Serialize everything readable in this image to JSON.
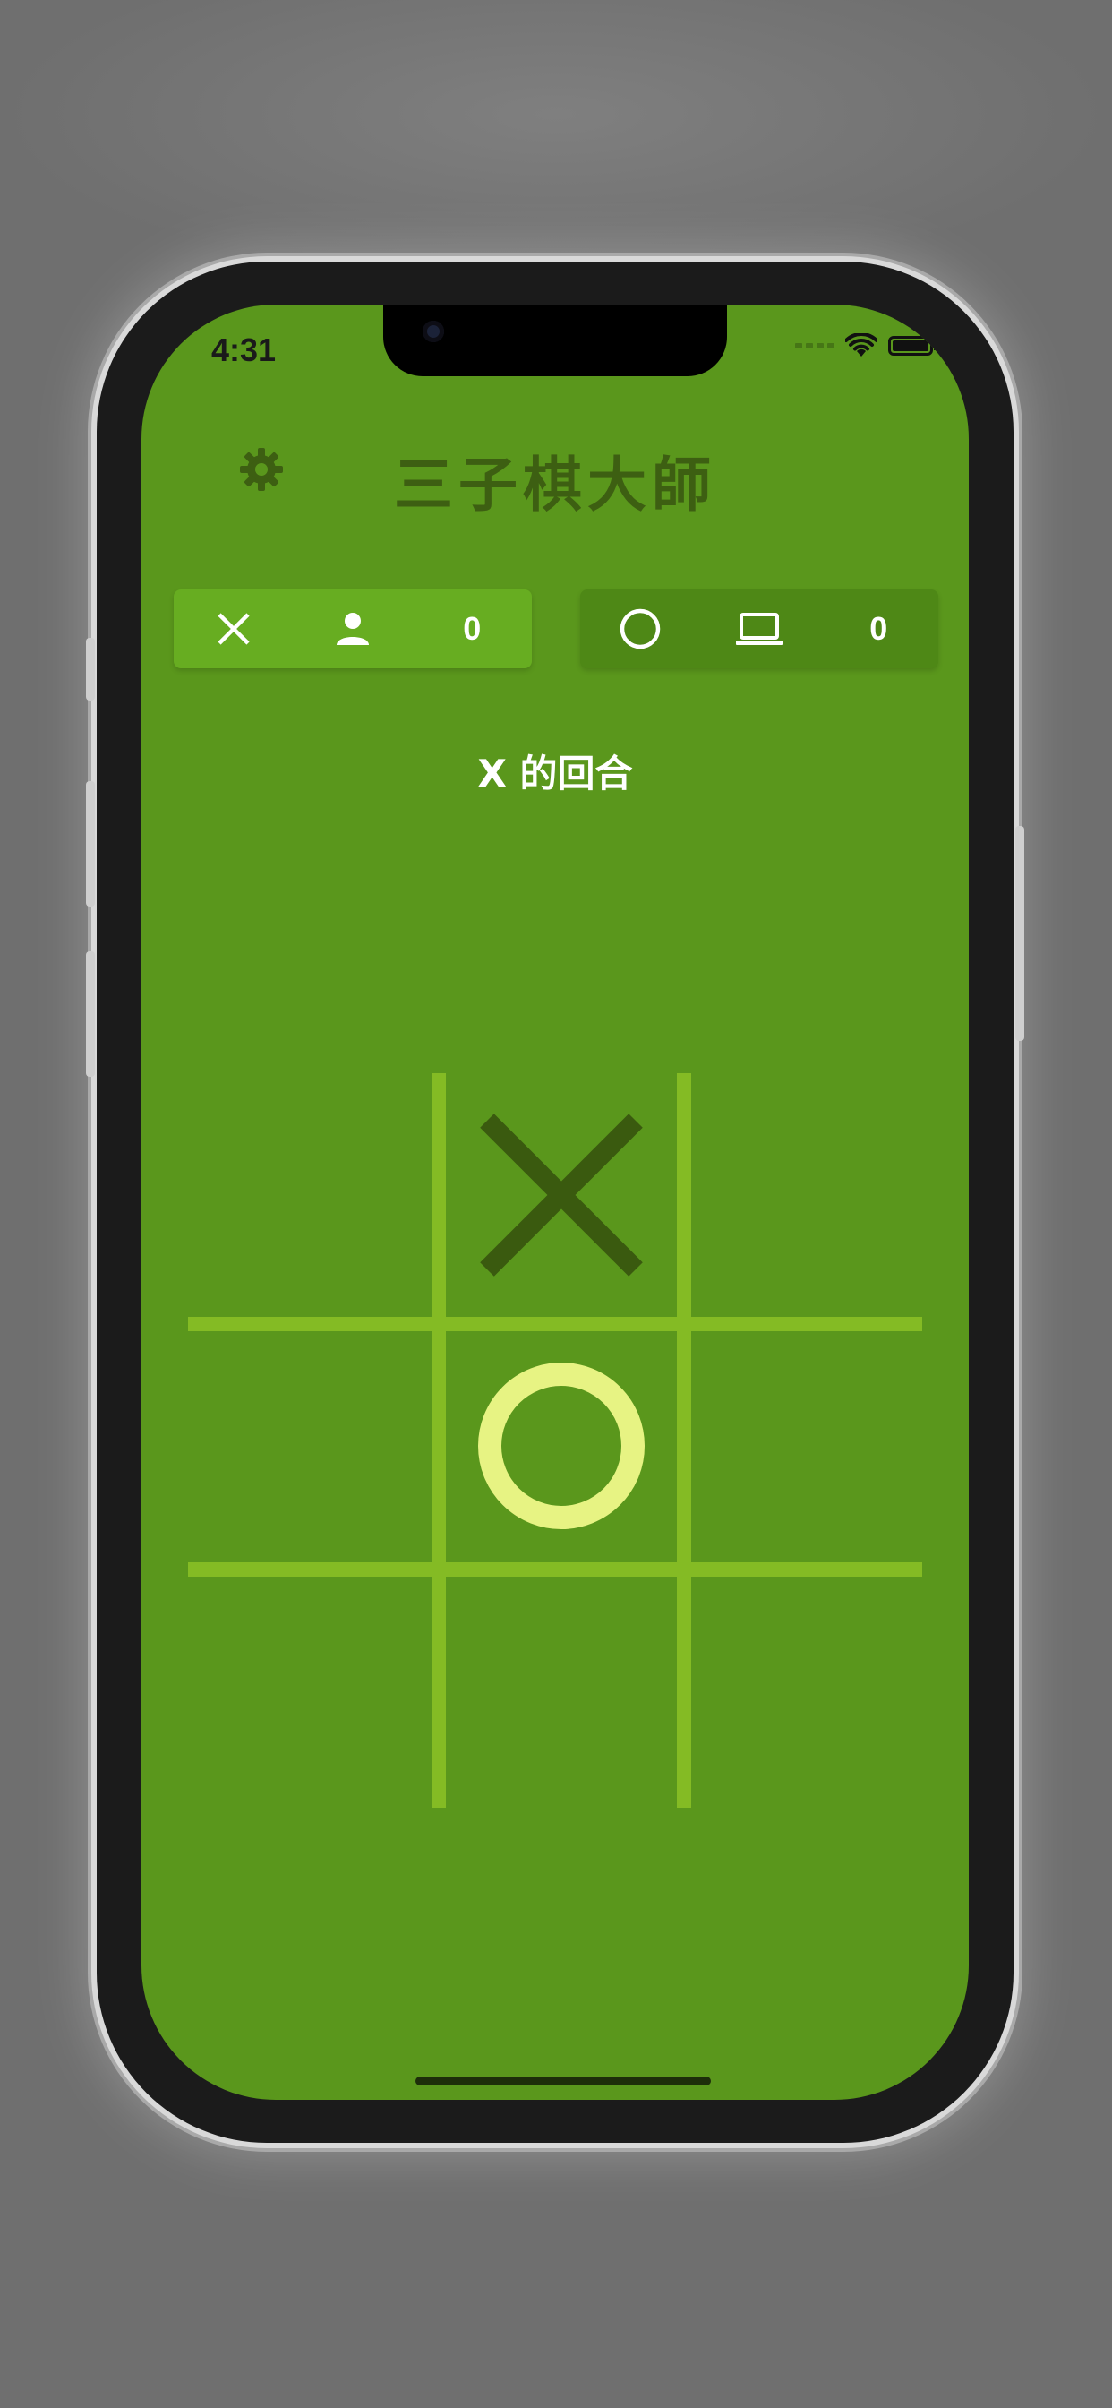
{
  "status_bar": {
    "time": "4:31"
  },
  "header": {
    "title": "三子棋大師",
    "settings_icon": "gear-icon"
  },
  "players": [
    {
      "mark": "X",
      "mark_icon": "x-icon",
      "type_icon": "person-icon",
      "score": "0"
    },
    {
      "mark": "O",
      "mark_icon": "circle-icon",
      "type_icon": "laptop-icon",
      "score": "0"
    }
  ],
  "turn": {
    "label": "X 的回合"
  },
  "board": {
    "cells": [
      "",
      "X",
      "",
      "",
      "O",
      "",
      "",
      "",
      ""
    ]
  },
  "colors": {
    "background": "#5a971c",
    "active_card": "#67ad21",
    "inactive_card": "#4e8816",
    "grid": "#84bb24",
    "x_mark": "#3a5a0f",
    "o_mark": "#e7f383",
    "title": "#3d5f12"
  }
}
